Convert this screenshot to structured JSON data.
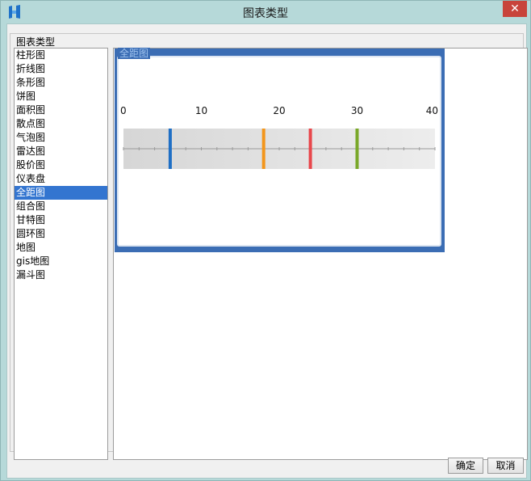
{
  "window": {
    "title": "图表类型"
  },
  "group": {
    "label": "图表类型"
  },
  "chart_types": [
    {
      "label": "柱形图"
    },
    {
      "label": "折线图"
    },
    {
      "label": "条形图"
    },
    {
      "label": "饼图"
    },
    {
      "label": "面积图"
    },
    {
      "label": "散点图"
    },
    {
      "label": "气泡图"
    },
    {
      "label": "雷达图"
    },
    {
      "label": "股价图"
    },
    {
      "label": "仪表盘"
    },
    {
      "label": "全距图",
      "selected": true
    },
    {
      "label": "组合图"
    },
    {
      "label": "甘特图"
    },
    {
      "label": "圆环图"
    },
    {
      "label": "地图"
    },
    {
      "label": "gis地图"
    },
    {
      "label": "漏斗图"
    }
  ],
  "preview": {
    "label": "全距图"
  },
  "chart_data": {
    "type": "range",
    "xlim": [
      0,
      40
    ],
    "ticks": [
      0,
      10,
      20,
      30,
      40
    ],
    "tick_labels": [
      "0",
      "10",
      "20",
      "30",
      "40"
    ],
    "markers": [
      {
        "value": 6,
        "color": "#1f6fc5"
      },
      {
        "value": 18,
        "color": "#f3961c"
      },
      {
        "value": 24,
        "color": "#e8474c"
      },
      {
        "value": 30,
        "color": "#7aa82a"
      }
    ]
  },
  "buttons": {
    "ok": "确定",
    "cancel": "取消"
  },
  "colors": {
    "selection": "#3375d0",
    "card_border": "#3b6db4"
  }
}
